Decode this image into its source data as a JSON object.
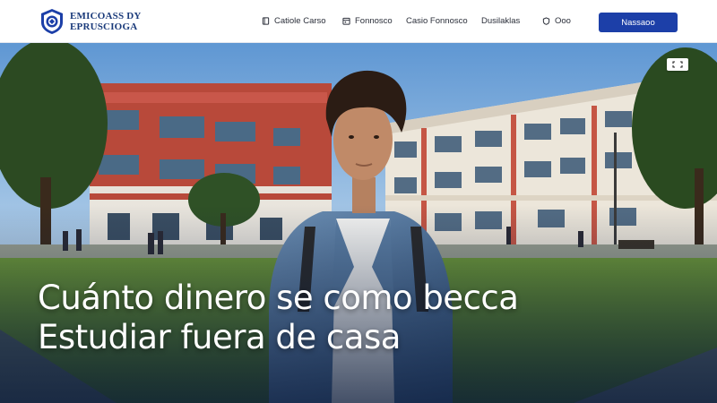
{
  "header": {
    "logo": {
      "line1": "EMICOASS DY",
      "line2": "EPRUSCIOGA",
      "icon": "shield-crest-icon"
    },
    "nav": [
      {
        "label": "Catiole Carso",
        "icon": "book-icon"
      },
      {
        "label": "Fonnosco",
        "icon": "calendar-icon"
      },
      {
        "label": "Casio Fonnosco",
        "icon": null
      },
      {
        "label": "Dusilaklas",
        "icon": null
      },
      {
        "label": "Ooo",
        "icon": "info-icon"
      }
    ],
    "cta_label": "Nassaoo"
  },
  "hero": {
    "headline_line1": "Cuánto dinero se como becca",
    "headline_line2": "Estudiar fuera de casa",
    "expand_icon": "expand-icon"
  },
  "colors": {
    "brand": "#1c3fa8",
    "logo_text": "#1a3a7a",
    "sky": "#7fb2e0",
    "grass": "#5d8a2e",
    "brick": "#b8493a"
  }
}
